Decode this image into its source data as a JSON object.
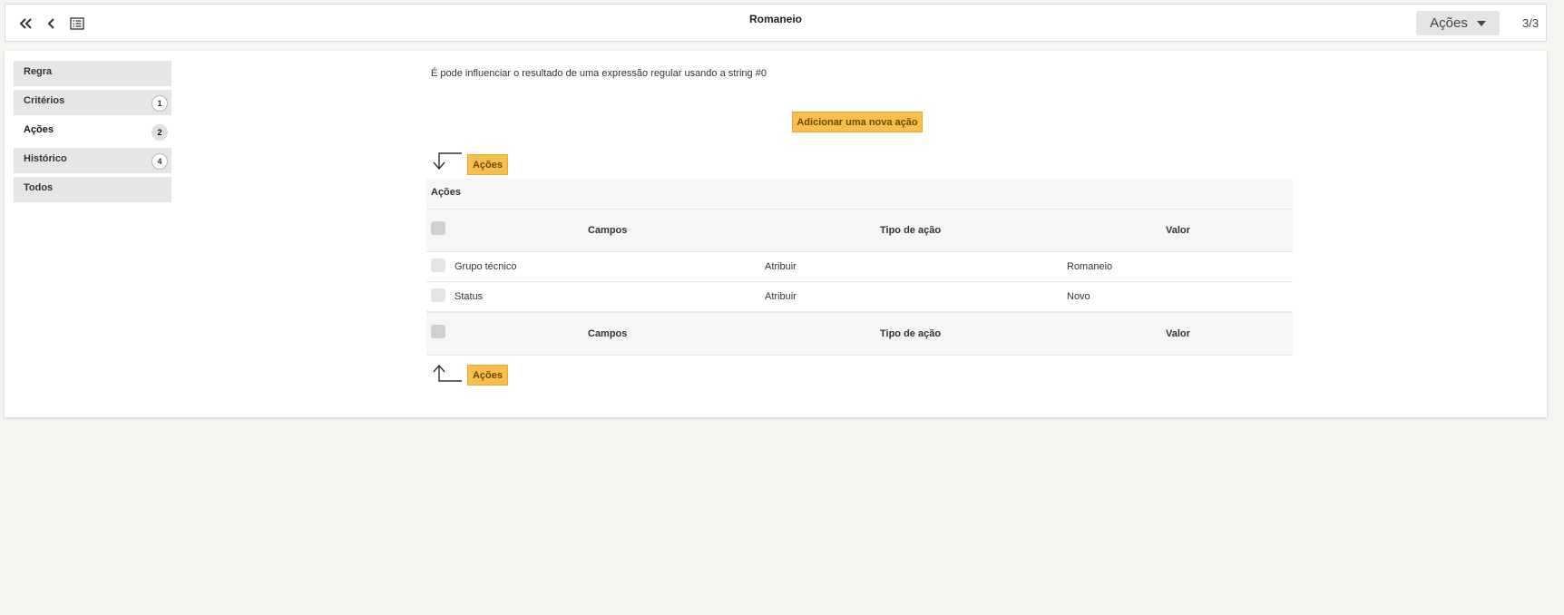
{
  "header": {
    "title": "Romaneio",
    "actions_label": "Ações",
    "pager": "3/3"
  },
  "sidebar": {
    "items": [
      {
        "label": "Regra",
        "badge": ""
      },
      {
        "label": "Critérios",
        "badge": "1"
      },
      {
        "label": "Ações",
        "badge": "2"
      },
      {
        "label": "Histórico",
        "badge": "4"
      },
      {
        "label": "Todos",
        "badge": ""
      }
    ]
  },
  "main": {
    "info_text": "É pode influenciar o resultado de uma expressão regular usando a string #0",
    "add_button": "Adicionar uma nova ação",
    "top_pill": "Ações",
    "bottom_pill": "Ações",
    "table": {
      "title": "Ações",
      "headers": [
        "Campos",
        "Tipo de ação",
        "Valor"
      ],
      "rows": [
        {
          "campo": "Grupo técnico",
          "tipo": "Atribuir",
          "valor": "Romaneio"
        },
        {
          "campo": "Status",
          "tipo": "Atribuir",
          "valor": "Novo"
        }
      ]
    }
  },
  "icons": {
    "first": "double-chevron-left-icon",
    "prev": "chevron-left-icon",
    "list": "list-icon",
    "arrow_down": "arrow-down-corner-icon",
    "arrow_up": "arrow-up-corner-icon"
  },
  "colors": {
    "accent": "#f9bf4c",
    "accent_border": "#eaa936",
    "sidebar_bg": "#e6e6e6",
    "page_bg": "#f6f5f2"
  }
}
